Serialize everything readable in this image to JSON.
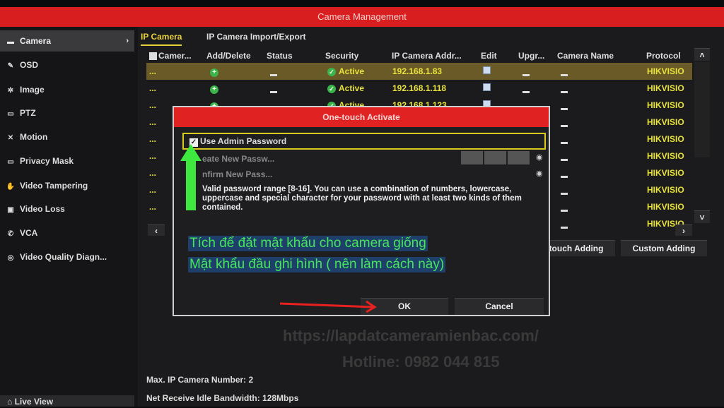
{
  "window": {
    "title": "Camera Management"
  },
  "sidebar": {
    "items": [
      {
        "label": "Camera",
        "icon": "camera-icon",
        "active": true
      },
      {
        "label": "OSD",
        "icon": "osd-icon"
      },
      {
        "label": "Image",
        "icon": "image-icon"
      },
      {
        "label": "PTZ",
        "icon": "ptz-icon"
      },
      {
        "label": "Motion",
        "icon": "motion-icon"
      },
      {
        "label": "Privacy Mask",
        "icon": "privacy-mask-icon"
      },
      {
        "label": "Video Tampering",
        "icon": "video-tampering-icon"
      },
      {
        "label": "Video Loss",
        "icon": "video-loss-icon"
      },
      {
        "label": "VCA",
        "icon": "vca-icon"
      },
      {
        "label": "Video Quality Diagn...",
        "icon": "video-quality-icon"
      }
    ],
    "live_view": "Live View"
  },
  "tabs": [
    {
      "label": "IP Camera",
      "active": true
    },
    {
      "label": "IP Camera Import/Export"
    }
  ],
  "table": {
    "headers": [
      "Camer...",
      "Add/Delete",
      "Status",
      "Security",
      "IP Camera Addr...",
      "Edit",
      "Upgr...",
      "Camera Name",
      "Protocol"
    ],
    "rows": [
      {
        "num": "...",
        "security": "Active",
        "ip": "192.168.1.83",
        "protocol": "HIKVISIO"
      },
      {
        "num": "...",
        "security": "Active",
        "ip": "192.168.1.118",
        "protocol": "HIKVISIO"
      },
      {
        "num": "...",
        "security": "Active",
        "ip": "192.168.1.123",
        "protocol": "HIKVISIO"
      },
      {
        "num": "...",
        "protocol": "HIKVISIO"
      },
      {
        "num": "...",
        "protocol": "HIKVISIO"
      },
      {
        "num": "...",
        "protocol": "HIKVISIO"
      },
      {
        "num": "...",
        "protocol": "HIKVISIO"
      },
      {
        "num": "...",
        "protocol": "HIKVISIO"
      },
      {
        "num": "...",
        "protocol": "HIKVISIO"
      },
      {
        "num": "...",
        "protocol": "HIKVISIO"
      }
    ]
  },
  "buttons": {
    "one_touch": "touch Adding",
    "custom": "Custom Adding"
  },
  "info": {
    "max_cam": "Max. IP Camera Number: 2",
    "bandwidth": "Net Receive Idle Bandwidth: 128Mbps"
  },
  "dialog": {
    "title": "One-touch Activate",
    "use_admin": "Use Admin Password",
    "use_admin_checked": true,
    "create_label": "eate New Passw...",
    "confirm_label": "nfirm New Pass...",
    "help": "Valid password range [8-16]. You can use a combination of numbers, lowercase, uppercase and special character for your password with at least two kinds of them contained.",
    "ok": "OK",
    "cancel": "Cancel"
  },
  "annotation": {
    "line1": "Tích để đặt mật khẩu cho camera giống",
    "line2": "Mật khẩu đầu ghi hình ( nên làm cách này)",
    "text_color": "#46e65a",
    "arrow_colors": [
      "#3ee83e",
      "#e82020"
    ]
  },
  "watermark": {
    "url": "https://lapdatcameramienbac.com/",
    "hotline": "Hotline: 0982 044 815"
  },
  "colors": {
    "titlebar": "#d81e1e",
    "accent": "#e8e23a"
  }
}
